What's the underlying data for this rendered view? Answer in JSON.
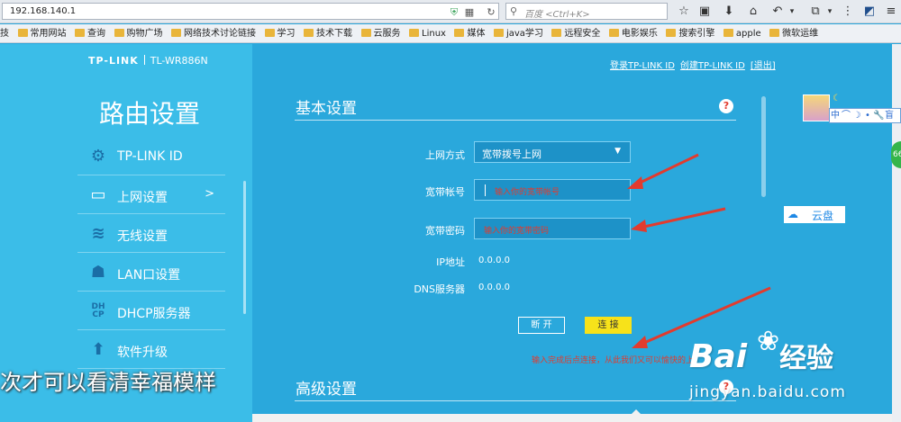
{
  "browser": {
    "url": "192.168.140.1",
    "search_placeholder": "百度 <Ctrl+K>",
    "bookmarks": [
      "技",
      "常用网站",
      "查询",
      "购物广场",
      "网络技术讨论链接",
      "学习",
      "技术下载",
      "云服务",
      "Linux",
      "媒体",
      "java学习",
      "远程安全",
      "电影娱乐",
      "搜索引擎",
      "apple",
      "微软运维"
    ]
  },
  "sidebar": {
    "brand": "TP-LINK",
    "model": "TL-WR886N",
    "title": "路由设置",
    "items": [
      {
        "label": "TP-LINK ID",
        "icon": "gear-icon"
      },
      {
        "label": "上网设置",
        "icon": "monitor-icon",
        "chevron": ">"
      },
      {
        "label": "无线设置",
        "icon": "wifi-icon"
      },
      {
        "label": "LAN口设置",
        "icon": "lan-icon"
      },
      {
        "label": "DHCP服务器",
        "icon": "dhcp-icon",
        "icon_text": "DH CP"
      },
      {
        "label": "软件升级",
        "icon": "upload-icon"
      }
    ],
    "overlay_text": "次才可以看清幸福模样"
  },
  "header": {
    "links": [
      "登录TP-LINK ID",
      "创建TP-LINK ID",
      "[退出]"
    ]
  },
  "basic": {
    "title": "基本设置",
    "help": "?",
    "fields": {
      "mode_label": "上网方式",
      "mode_value": "宽带拨号上网",
      "account_label": "宽带帐号",
      "account_placeholder": "输入你的宽带帐号",
      "password_label": "宽带密码",
      "password_placeholder": "输入你的宽带密码",
      "ip_label": "IP地址",
      "ip_value": "0.0.0.0",
      "dns_label": "DNS服务器",
      "dns_value": "0.0.0.0"
    },
    "buttons": {
      "disconnect": "断 开",
      "connect": "连 接"
    },
    "note": "输入完成后点连接，从此我们又可以愉快的上"
  },
  "advanced": {
    "title": "高级设置",
    "help": "?"
  },
  "widgets": {
    "ime": [
      "中",
      "⌒",
      "☽",
      "•",
      "🔧",
      "盲"
    ],
    "badge": "66",
    "yunpan": "云盘"
  },
  "watermark": {
    "logo": "Bai",
    "logo2": "经验",
    "sub": "jingyan.baidu.com"
  },
  "colors": {
    "page_bg": "#2aa8dc",
    "sidebar_bg": "#3bbde8",
    "accent_yellow": "#f7e21a",
    "annotation_red": "#e23b2e"
  }
}
